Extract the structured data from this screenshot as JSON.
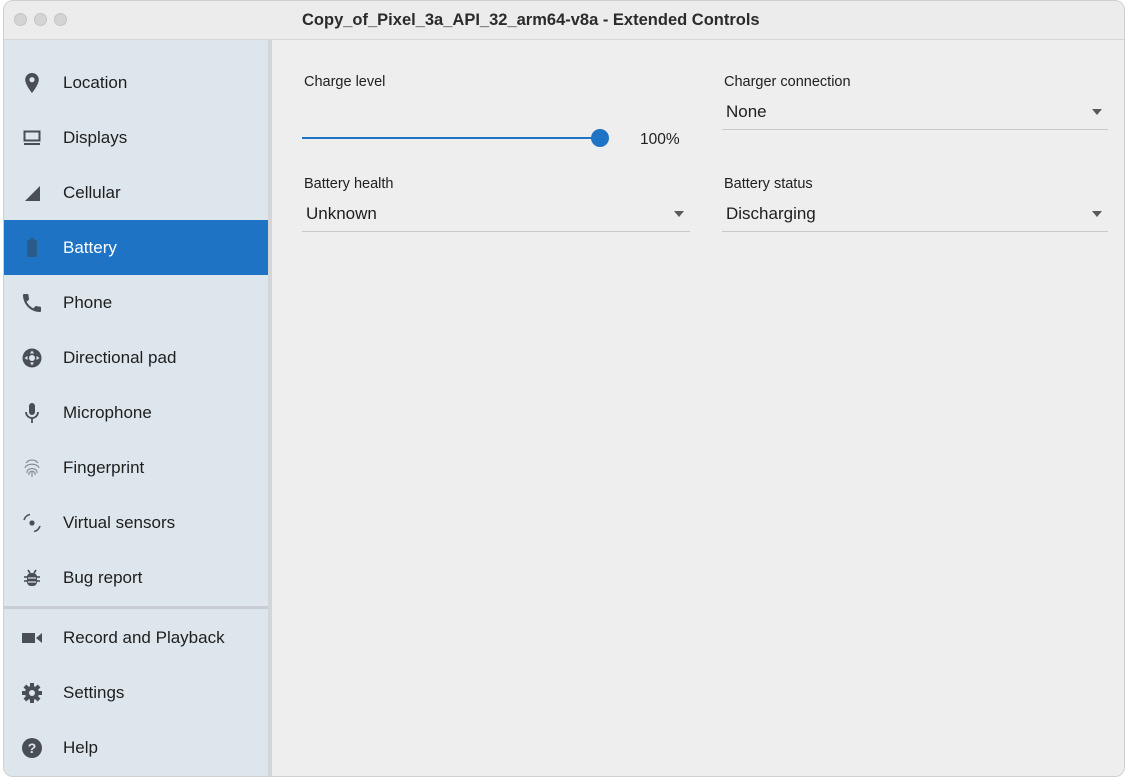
{
  "window": {
    "title": "Copy_of_Pixel_3a_API_32_arm64-v8a - Extended Controls"
  },
  "sidebar": {
    "items": [
      {
        "label": "Location",
        "icon": "location-pin-icon"
      },
      {
        "label": "Displays",
        "icon": "monitor-icon"
      },
      {
        "label": "Cellular",
        "icon": "signal-icon"
      },
      {
        "label": "Battery",
        "icon": "battery-icon",
        "active": true
      },
      {
        "label": "Phone",
        "icon": "phone-icon"
      },
      {
        "label": "Directional pad",
        "icon": "dpad-icon"
      },
      {
        "label": "Microphone",
        "icon": "microphone-icon"
      },
      {
        "label": "Fingerprint",
        "icon": "fingerprint-icon"
      },
      {
        "label": "Virtual sensors",
        "icon": "rotation-sensor-icon"
      },
      {
        "label": "Bug report",
        "icon": "bug-icon"
      }
    ],
    "footer_items": [
      {
        "label": "Record and Playback",
        "icon": "video-camera-icon"
      },
      {
        "label": "Settings",
        "icon": "gear-icon"
      },
      {
        "label": "Help",
        "icon": "help-icon"
      }
    ]
  },
  "battery": {
    "charge_level_label": "Charge level",
    "charge_level_value": 100,
    "charge_level_text": "100%",
    "charger_connection_label": "Charger connection",
    "charger_connection_value": "None",
    "battery_health_label": "Battery health",
    "battery_health_value": "Unknown",
    "battery_status_label": "Battery status",
    "battery_status_value": "Discharging"
  },
  "colors": {
    "accent": "#1f73c5",
    "sidebar_bg": "#dde6ed",
    "content_bg": "#eeeeee"
  }
}
